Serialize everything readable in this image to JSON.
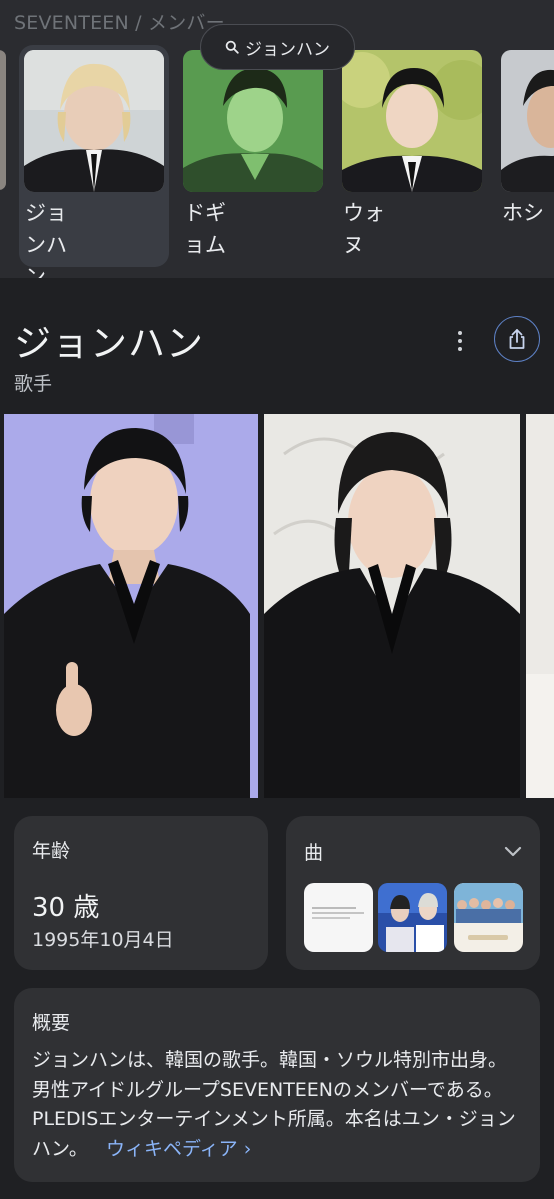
{
  "breadcrumb": "SEVENTEEN / メンバー",
  "search_chip": "ジョンハン",
  "members": [
    {
      "name": "ジョンハン",
      "selected": true
    },
    {
      "name": "ドギョム",
      "selected": false
    },
    {
      "name": "ウォヌ",
      "selected": false
    },
    {
      "name": "ホシ",
      "selected": false
    }
  ],
  "entity": {
    "title": "ジョンハン",
    "subtitle": "歌手"
  },
  "age_card": {
    "label": "年齢",
    "value": "30 歳",
    "birthdate": "1995年10月4日"
  },
  "songs_card": {
    "label": "曲"
  },
  "summary_card": {
    "label": "概要",
    "text": "ジョンハンは、韓国の歌手。韓国・ソウル特別市出身。男性アイドルグループSEVENTEENのメンバーである。PLEDISエンターテインメント所属。本名はユン・ジョンハン。",
    "link": "ウィキペディア"
  },
  "colors": {
    "background": "#1f2023",
    "panel": "#2b2c30",
    "card": "#303134",
    "selected": "#3a3d44",
    "link": "#8ab4f8",
    "share_ring": "#5d80c4"
  }
}
